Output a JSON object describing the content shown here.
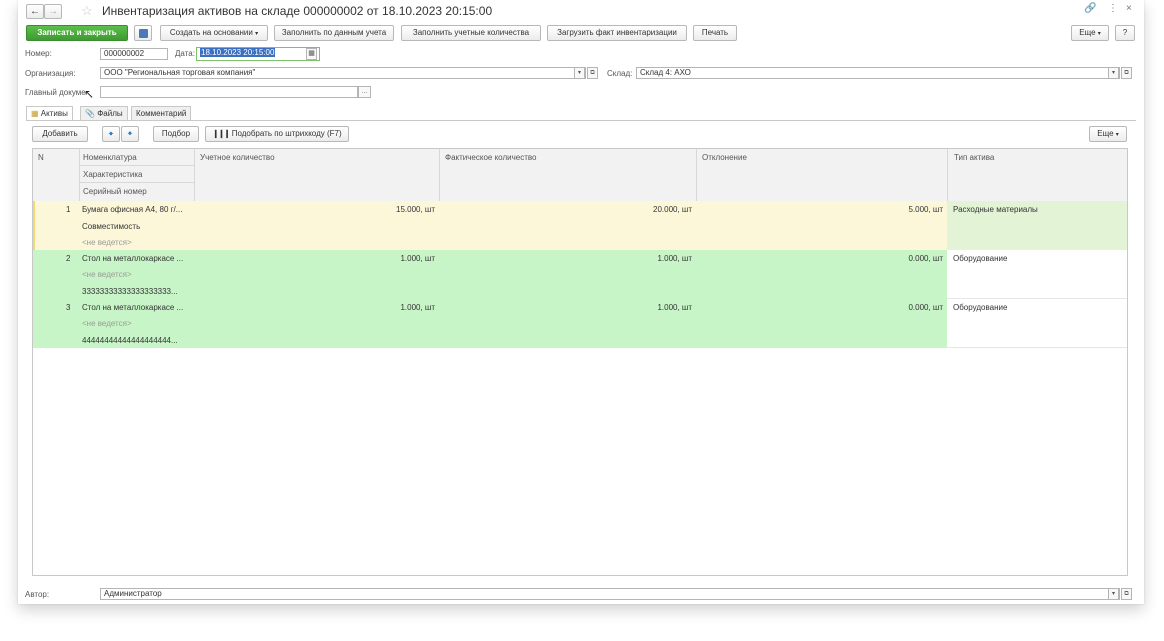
{
  "window": {
    "title": "Инвентаризация активов на складе 000000002 от 18.10.2023 20:15:00"
  },
  "toolbar": {
    "save_close": "Записать и закрыть",
    "create_based": "Создать на основании",
    "fill_accounting": "Заполнить по данным учета",
    "fill_quantities": "Заполнить учетные количества",
    "load_fact": "Загрузить факт инвентаризации",
    "print": "Печать",
    "more": "Еще",
    "help": "?"
  },
  "form": {
    "number_label": "Номер:",
    "number_value": "000000002",
    "date_label": "Дата:",
    "date_value": "18.10.2023 20:15:00",
    "org_label": "Организация:",
    "org_value": "ООО \"Региональная торговая компания\"",
    "warehouse_label": "Склад:",
    "warehouse_value": "Склад 4: АХО",
    "main_doc_label": "Главный докуме",
    "main_doc_value": ""
  },
  "tabs": [
    {
      "label": "Активы",
      "active": true
    },
    {
      "label": "Файлы",
      "active": false
    },
    {
      "label": "Комментарий",
      "active": false
    }
  ],
  "table_toolbar": {
    "add": "Добавить",
    "pick": "Подбор",
    "pick_barcode": "Подобрать по штрихкоду (F7)",
    "more": "Еще"
  },
  "table": {
    "headers": {
      "n": "N",
      "nomenclature": "Номенклатура",
      "characteristic": "Характеристика",
      "serial": "Серийный номер",
      "accounting_qty": "Учетное количество",
      "actual_qty": "Фактическое количество",
      "deviation": "Отклонение",
      "asset_type": "Тип актива"
    },
    "rows": [
      {
        "n": "1",
        "nomenclature": "Бумага офисная А4, 80 г/...",
        "characteristic": "Совместимость",
        "serial": "<не ведется>",
        "accounting_qty": "15.000, шт",
        "actual_qty": "20.000, шт",
        "deviation": "5.000, шт",
        "asset_type": "Расходные материалы"
      },
      {
        "n": "2",
        "nomenclature": "Стол на металлокаркасе ...",
        "characteristic": "<не ведется>",
        "serial": "33333333333333333333...",
        "accounting_qty": "1.000, шт",
        "actual_qty": "1.000, шт",
        "deviation": "0.000, шт",
        "asset_type": "Оборудование"
      },
      {
        "n": "3",
        "nomenclature": "Стол на металлокаркасе ...",
        "characteristic": "<не ведется>",
        "serial": "44444444444444444444...",
        "accounting_qty": "1.000, шт",
        "actual_qty": "1.000, шт",
        "deviation": "0.000, шт",
        "asset_type": "Оборудование"
      }
    ]
  },
  "footer": {
    "author_label": "Автор:",
    "author_value": "Администратор"
  },
  "colors": {
    "row_selected": "#fdf7da",
    "row_selected_type": "#e3f3d6",
    "row_green": "#c8f5c8",
    "primary_button": "#4caf3a"
  }
}
